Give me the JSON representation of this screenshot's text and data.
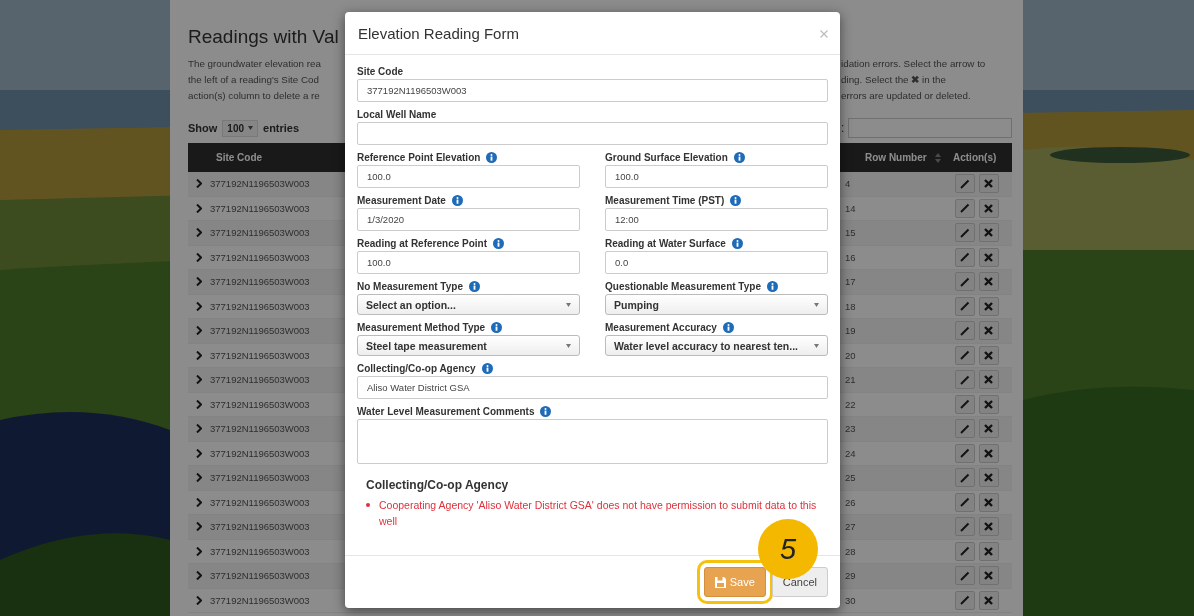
{
  "page": {
    "title": "Readings with Val",
    "description_left": [
      "The groundwater elevation rea",
      "the left of a reading's Site Cod",
      "action(s) column to delete a re"
    ],
    "description_right": [
      "idation errors. Select the arrow to",
      "ding. Select the **✖** in the",
      "errors are updated or deleted."
    ],
    "length": {
      "show": "Show",
      "value": "100",
      "entries": "entries"
    },
    "search_label": ":",
    "table": {
      "columns": [
        "Site Code",
        "Row Number",
        "Action(s)"
      ],
      "rows": [
        {
          "site_code": "377192N1196503W003",
          "row_number": "4"
        },
        {
          "site_code": "377192N1196503W003",
          "row_number": "14"
        },
        {
          "site_code": "377192N1196503W003",
          "row_number": "15"
        },
        {
          "site_code": "377192N1196503W003",
          "row_number": "16"
        },
        {
          "site_code": "377192N1196503W003",
          "row_number": "17"
        },
        {
          "site_code": "377192N1196503W003",
          "row_number": "18"
        },
        {
          "site_code": "377192N1196503W003",
          "row_number": "19"
        },
        {
          "site_code": "377192N1196503W003",
          "row_number": "20"
        },
        {
          "site_code": "377192N1196503W003",
          "row_number": "21"
        },
        {
          "site_code": "377192N1196503W003",
          "row_number": "22"
        },
        {
          "site_code": "377192N1196503W003",
          "row_number": "23"
        },
        {
          "site_code": "377192N1196503W003",
          "row_number": "24"
        },
        {
          "site_code": "377192N1196503W003",
          "row_number": "25"
        },
        {
          "site_code": "377192N1196503W003",
          "row_number": "26"
        },
        {
          "site_code": "377192N1196503W003",
          "row_number": "27"
        },
        {
          "site_code": "377192N1196503W003",
          "row_number": "28"
        },
        {
          "site_code": "377192N1196503W003",
          "row_number": "29"
        },
        {
          "site_code": "377192N1196503W003",
          "row_number": "30"
        }
      ]
    }
  },
  "modal": {
    "title": "Elevation Reading Form",
    "field_rows": [
      [
        {
          "kind": "text",
          "label": "Site Code",
          "info": false,
          "value": "377192N1196503W003"
        }
      ],
      [
        {
          "kind": "text",
          "label": "Local Well Name",
          "info": false
        }
      ],
      [
        {
          "kind": "text",
          "label": "Reference Point Elevation",
          "info": true,
          "value": "100.0"
        },
        {
          "kind": "text",
          "label": "Ground Surface Elevation",
          "info": true,
          "value": "100.0"
        }
      ],
      [
        {
          "kind": "text",
          "label": "Measurement Date",
          "info": true,
          "value": "1/3/2020"
        },
        {
          "kind": "text",
          "label": "Measurement Time (PST)",
          "info": true,
          "value": "12:00"
        }
      ],
      [
        {
          "kind": "text",
          "label": "Reading at Reference Point",
          "info": true,
          "value": "100.0"
        },
        {
          "kind": "text",
          "label": "Reading at Water Surface",
          "info": true,
          "value": "0.0"
        }
      ],
      [
        {
          "kind": "select",
          "label": "No Measurement Type",
          "info": true,
          "value": "Select an option..."
        },
        {
          "kind": "select",
          "label": "Questionable Measurement Type",
          "info": true,
          "value": "Pumping"
        }
      ],
      [
        {
          "kind": "select",
          "label": "Measurement Method Type",
          "info": true,
          "value": "Steel tape measurement"
        },
        {
          "kind": "select",
          "label": "Measurement Accuracy",
          "info": true,
          "value": "Water level accuracy to nearest ten..."
        }
      ],
      [
        {
          "kind": "text",
          "label": "Collecting/Co-op Agency",
          "info": true,
          "value": "Aliso Water District GSA"
        }
      ],
      [
        {
          "kind": "textarea",
          "label": "Water Level Measurement Comments",
          "info": true
        }
      ]
    ],
    "errors": {
      "heading": "Collecting/Co-op Agency",
      "messages": [
        "Cooperating Agency 'Aliso Water District GSA' does not have permission to submit data to this well"
      ]
    },
    "buttons": [
      {
        "label": "Save",
        "kind": "primary",
        "highlighted": true
      },
      {
        "label": "Cancel",
        "kind": "default",
        "highlighted": false
      }
    ],
    "callout": "5"
  }
}
